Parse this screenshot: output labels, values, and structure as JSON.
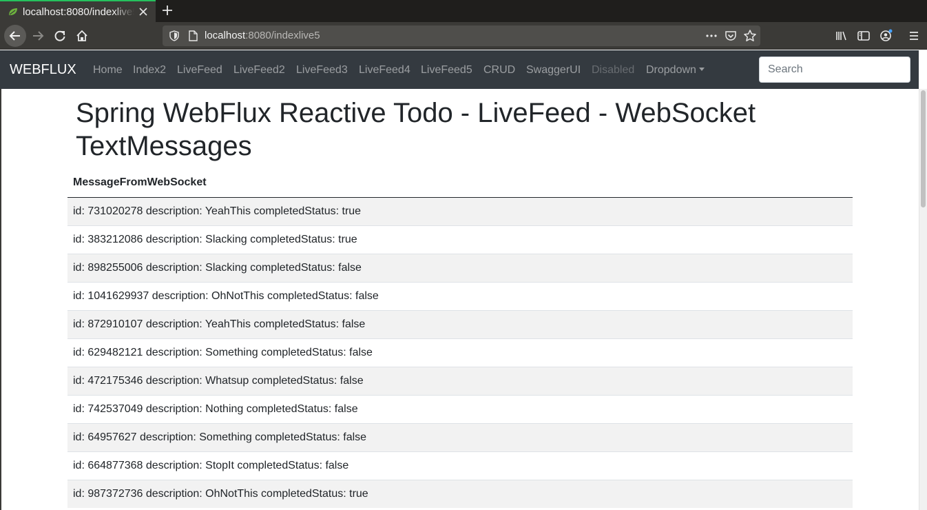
{
  "browser": {
    "tab_title": "localhost:8080/indexlive5",
    "url_host": "localhost",
    "url_rest": ":8080/indexlive5"
  },
  "navbar": {
    "brand": "WEBFLUX",
    "links": [
      "Home",
      "Index2",
      "LiveFeed",
      "LiveFeed2",
      "LiveFeed3",
      "LiveFeed4",
      "LiveFeed5",
      "CRUD",
      "SwaggerUI"
    ],
    "disabled_link": "Disabled",
    "dropdown_label": "Dropdown",
    "search_placeholder": "Search"
  },
  "main": {
    "title": "Spring WebFlux Reactive Todo - LiveFeed - WebSocket TextMessages",
    "table_header": "MessageFromWebSocket",
    "rows": [
      "id: 731020278 description: YeahThis completedStatus: true",
      "id: 383212086 description: Slacking completedStatus: true",
      "id: 898255006 description: Slacking completedStatus: false",
      "id: 1041629937 description: OhNotThis completedStatus: false",
      "id: 872910107 description: YeahThis completedStatus: false",
      "id: 629482121 description: Something completedStatus: false",
      "id: 472175346 description: Whatsup completedStatus: false",
      "id: 742537049 description: Nothing completedStatus: false",
      "id: 64957627 description: Something completedStatus: false",
      "id: 664877368 description: StopIt completedStatus: false",
      "id: 987372736 description: OhNotThis completedStatus: true"
    ]
  },
  "colors": {
    "navbar_bg": "#343a40",
    "stripe_bg": "#f2f2f2",
    "tab_accent": "#25c15d"
  }
}
